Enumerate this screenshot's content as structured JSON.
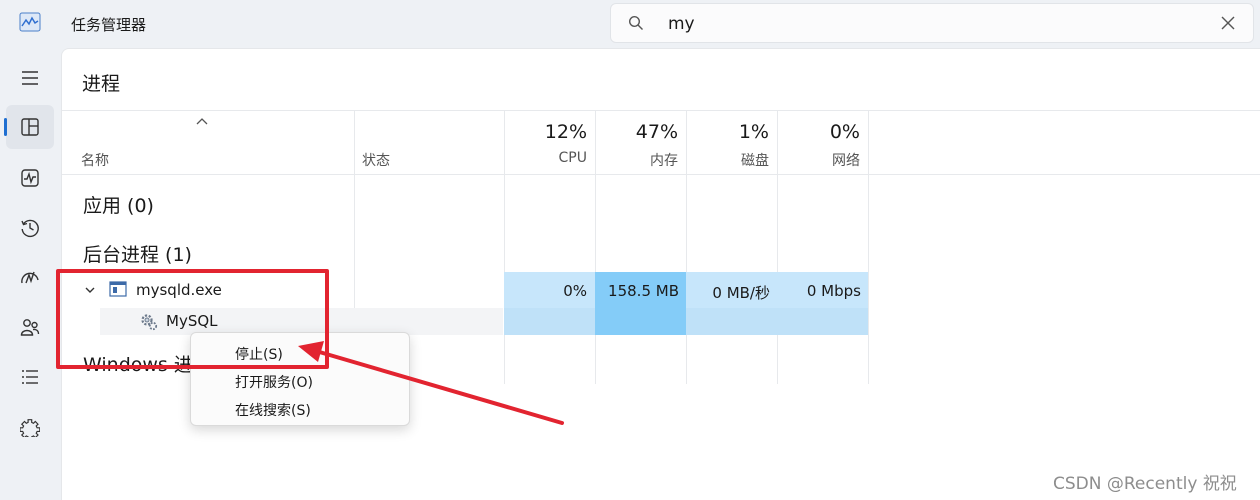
{
  "app": {
    "title": "任务管理器",
    "icon": "performance-chart-icon"
  },
  "search": {
    "value": "my",
    "placeholder": ""
  },
  "nav": {
    "items": [
      {
        "name": "hamburger-menu",
        "icon": "menu-icon"
      },
      {
        "name": "processes",
        "icon": "processes-icon",
        "active": true
      },
      {
        "name": "performance",
        "icon": "performance-icon"
      },
      {
        "name": "app-history",
        "icon": "history-icon"
      },
      {
        "name": "startup-apps",
        "icon": "startup-icon"
      },
      {
        "name": "users",
        "icon": "users-icon"
      },
      {
        "name": "details",
        "icon": "details-icon"
      },
      {
        "name": "services",
        "icon": "services-icon"
      }
    ]
  },
  "page": {
    "title": "进程"
  },
  "columns": {
    "name": "名称",
    "status": "状态",
    "cpu": {
      "pct": "12%",
      "label": "CPU"
    },
    "memory": {
      "pct": "47%",
      "label": "内存"
    },
    "disk": {
      "pct": "1%",
      "label": "磁盘"
    },
    "network": {
      "pct": "0%",
      "label": "网络"
    }
  },
  "groups": {
    "apps": "应用 (0)",
    "background": "后台进程 (1)",
    "windows": "Windows 进"
  },
  "process": {
    "name": "mysqld.exe",
    "cpu": "0%",
    "memory": "158.5 MB",
    "disk": "0 MB/秒",
    "network": "0 Mbps",
    "service": "MySQL"
  },
  "context_menu": {
    "items": [
      "停止(S)",
      "打开服务(O)",
      "在线搜索(S)"
    ]
  },
  "colors": {
    "heat_light": "#c7e6fb",
    "heat_strong": "#84ccf8",
    "annotation_red": "#e22430",
    "accent_blue": "#1f6fd1"
  },
  "watermark": "CSDN @Recently 祝祝"
}
